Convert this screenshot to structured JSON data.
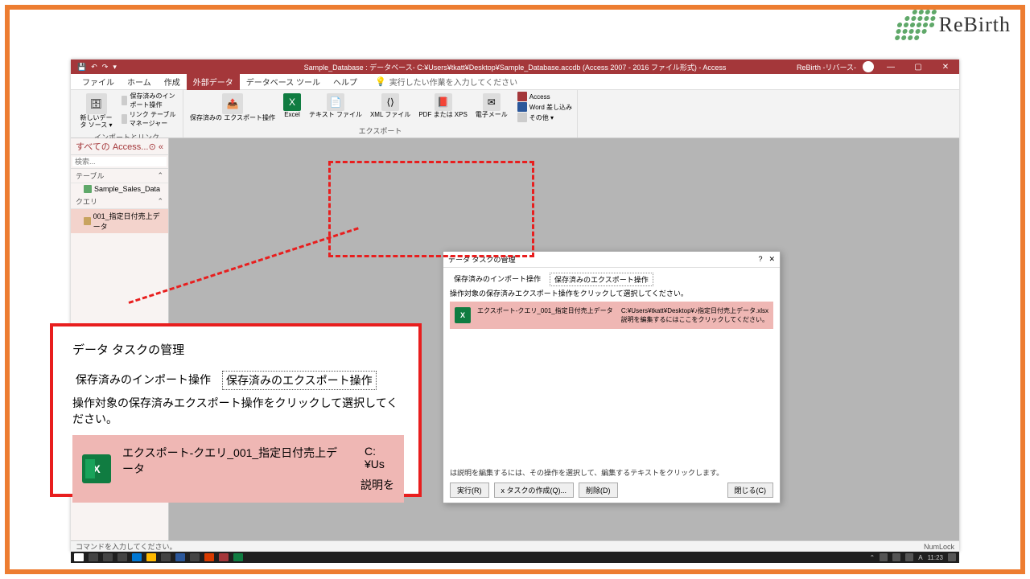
{
  "logo_text": "ReBirth",
  "titlebar": {
    "title": "Sample_Database : データベース- C:¥Users¥tkatt¥Desktop¥Sample_Database.accdb (Access 2007 - 2016 ファイル形式)  -  Access",
    "product": "ReBirth -リバース-"
  },
  "menu": {
    "file": "ファイル",
    "home": "ホーム",
    "create": "作成",
    "external": "外部データ",
    "dbtools": "データベース ツール",
    "help": "ヘルプ",
    "tell": "実行したい作業を入力してください"
  },
  "ribbon": {
    "new_source": "新しいデー\nタ ソース ▾",
    "saved_import": "保存済みのインポート操作",
    "link_manager": "リンク テーブル マネージャー",
    "group_import": "インポートとリンク",
    "saved_export": "保存済みの\nエクスポート操作",
    "excel": "Excel",
    "text": "テキスト\nファイル",
    "xml": "XML\nファイル",
    "pdf": "PDF または\nXPS",
    "email": "電子メール",
    "more_access": "Access",
    "more_word": "Word 差し込み",
    "more_other": "その他 ▾",
    "group_export": "エクスポート"
  },
  "nav": {
    "head": "すべての Access...",
    "search": "検索...",
    "tables": "テーブル",
    "table1": "Sample_Sales_Data",
    "queries": "クエリ",
    "query1": "001_指定日付売上データ"
  },
  "dialog": {
    "title": "データ タスクの管理",
    "tab_import": "保存済みのインポート操作",
    "tab_export": "保存済みのエクスポート操作",
    "instruction": "操作対象の保存済みエクスポート操作をクリックして選択してください。",
    "row_name": "エクスポート-クエリ_001_指定日付売上データ",
    "row_path": "C:¥Users¥tkatt¥Desktop¥♪指定日付売上データ.xlsx",
    "row_desc": "説明を編集するにはここをクリックしてください。",
    "hint": "は説明を編集するには、その操作を選択して、編集するテキストをクリックします。",
    "btn_run": "実行(R)",
    "btn_task": "x タスクの作成(Q)...",
    "btn_delete": "削除(D)",
    "btn_close": "閉じる(C)"
  },
  "zoom": {
    "title": "データ タスクの管理",
    "tab_import": "保存済みのインポート操作",
    "tab_export": "保存済みのエクスポート操作",
    "instruction": "操作対象の保存済みエクスポート操作をクリックして選択してください。",
    "row_name": "エクスポート-クエリ_001_指定日付売上データ",
    "row_path": "C:¥Us",
    "row_desc": "説明を"
  },
  "status": {
    "left": "コマンドを入力してください。",
    "right": "NumLock"
  },
  "taskbar_time": "11:23"
}
